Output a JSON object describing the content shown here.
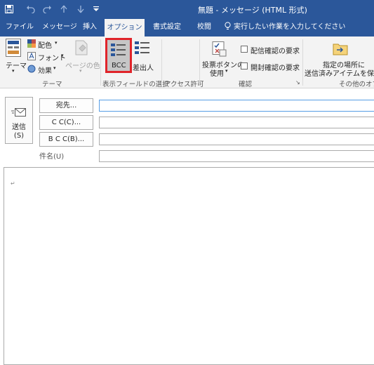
{
  "window": {
    "title": "無題 - メッセージ (HTML 形式)"
  },
  "quick_access": [
    {
      "icon": "save-icon"
    },
    {
      "icon": "undo-icon"
    },
    {
      "icon": "redo-icon"
    },
    {
      "icon": "up-arrow-icon"
    },
    {
      "icon": "down-arrow-icon"
    },
    {
      "icon": "customize-qat-icon"
    }
  ],
  "ribbon_tabs": {
    "file": "ファイル",
    "message": "メッセージ",
    "insert": "挿入",
    "options": "オプション",
    "format": "書式設定",
    "review": "校閲",
    "tell_me": "実行したい作業を入力してください"
  },
  "ribbon": {
    "theme": {
      "theme_label": "テーマ",
      "colors_label": "配色",
      "fonts_label": "フォント",
      "effects_label": "効果",
      "page_color_label": "ページの色",
      "group_label": "テーマ"
    },
    "show_fields": {
      "bcc_label": "BCC",
      "from_label": "差出人",
      "group_label": "表示フィールドの選択"
    },
    "permission": {
      "group_label": "アクセス許可"
    },
    "tracking": {
      "voting_label_line1": "投票ボタンの",
      "voting_label_line2": "使用",
      "delivery_receipt_label": "配信確認の要求",
      "read_receipt_label": "開封確認の要求",
      "group_label": "確認",
      "launcher_glyph": "↘"
    },
    "more_options": {
      "save_sent_label_line1": "指定の場所に",
      "save_sent_label_line2": "送信済みアイテムを保存",
      "group_label": "その他のオプ"
    }
  },
  "compose": {
    "send_label": "送信",
    "send_shortcut": "(S)",
    "to_button": "宛先...",
    "cc_button": "C C(C)...",
    "bcc_button": "B C C(B)...",
    "subject_label": "件名(U)",
    "to_value": "",
    "cc_value": "",
    "bcc_value": "",
    "subject_value": "",
    "body_mark": "↵"
  },
  "colors": {
    "title_bar": "#2b579a",
    "ribbon_bg": "#f3f3f3",
    "highlight": "#e0242a",
    "field_focus": "#569de5"
  }
}
